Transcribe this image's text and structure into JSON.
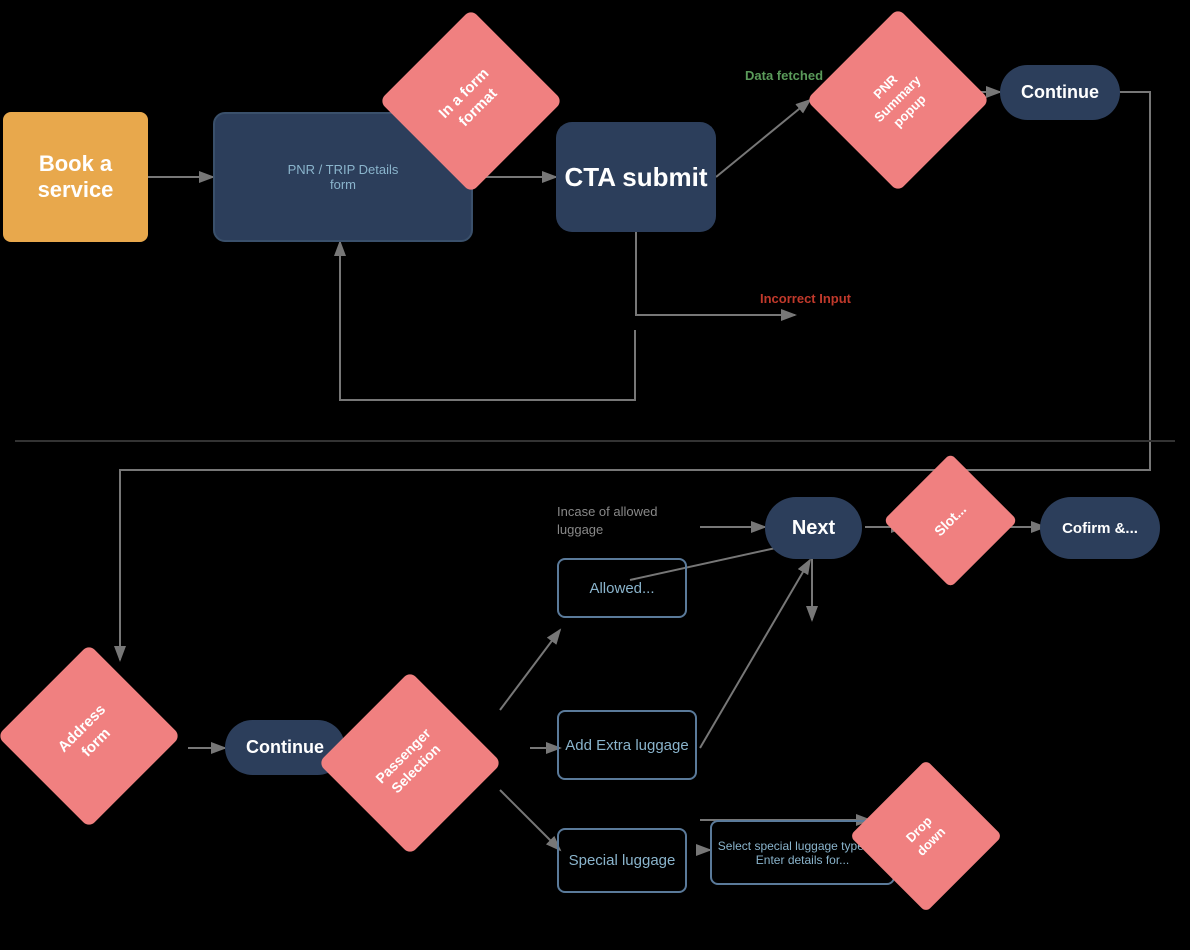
{
  "nodes": {
    "book_service": "Book a service",
    "cta_submit": "CTA submit",
    "in_form_format": "In a form\nformat",
    "pnr_summary": "PNR Summary popup",
    "continue_top": "Continue",
    "data_fetched": "Data fetched",
    "incorrect_input": "Incorrect Input",
    "address_form": "Address form",
    "continue_mid": "Continue",
    "passenger_selection": "Passenger Selection",
    "allowed_luggage": "Allowed...",
    "add_extra_luggage": "Add Extra luggage",
    "special_luggage": "Special luggage",
    "next": "Next",
    "slot": "Slot...",
    "confirm": "Cofirm &...",
    "drop_down": "Drop down",
    "select_special": "Select special luggage type and Enter details for...",
    "incase_allowed": "Incase of allowed luggage"
  }
}
